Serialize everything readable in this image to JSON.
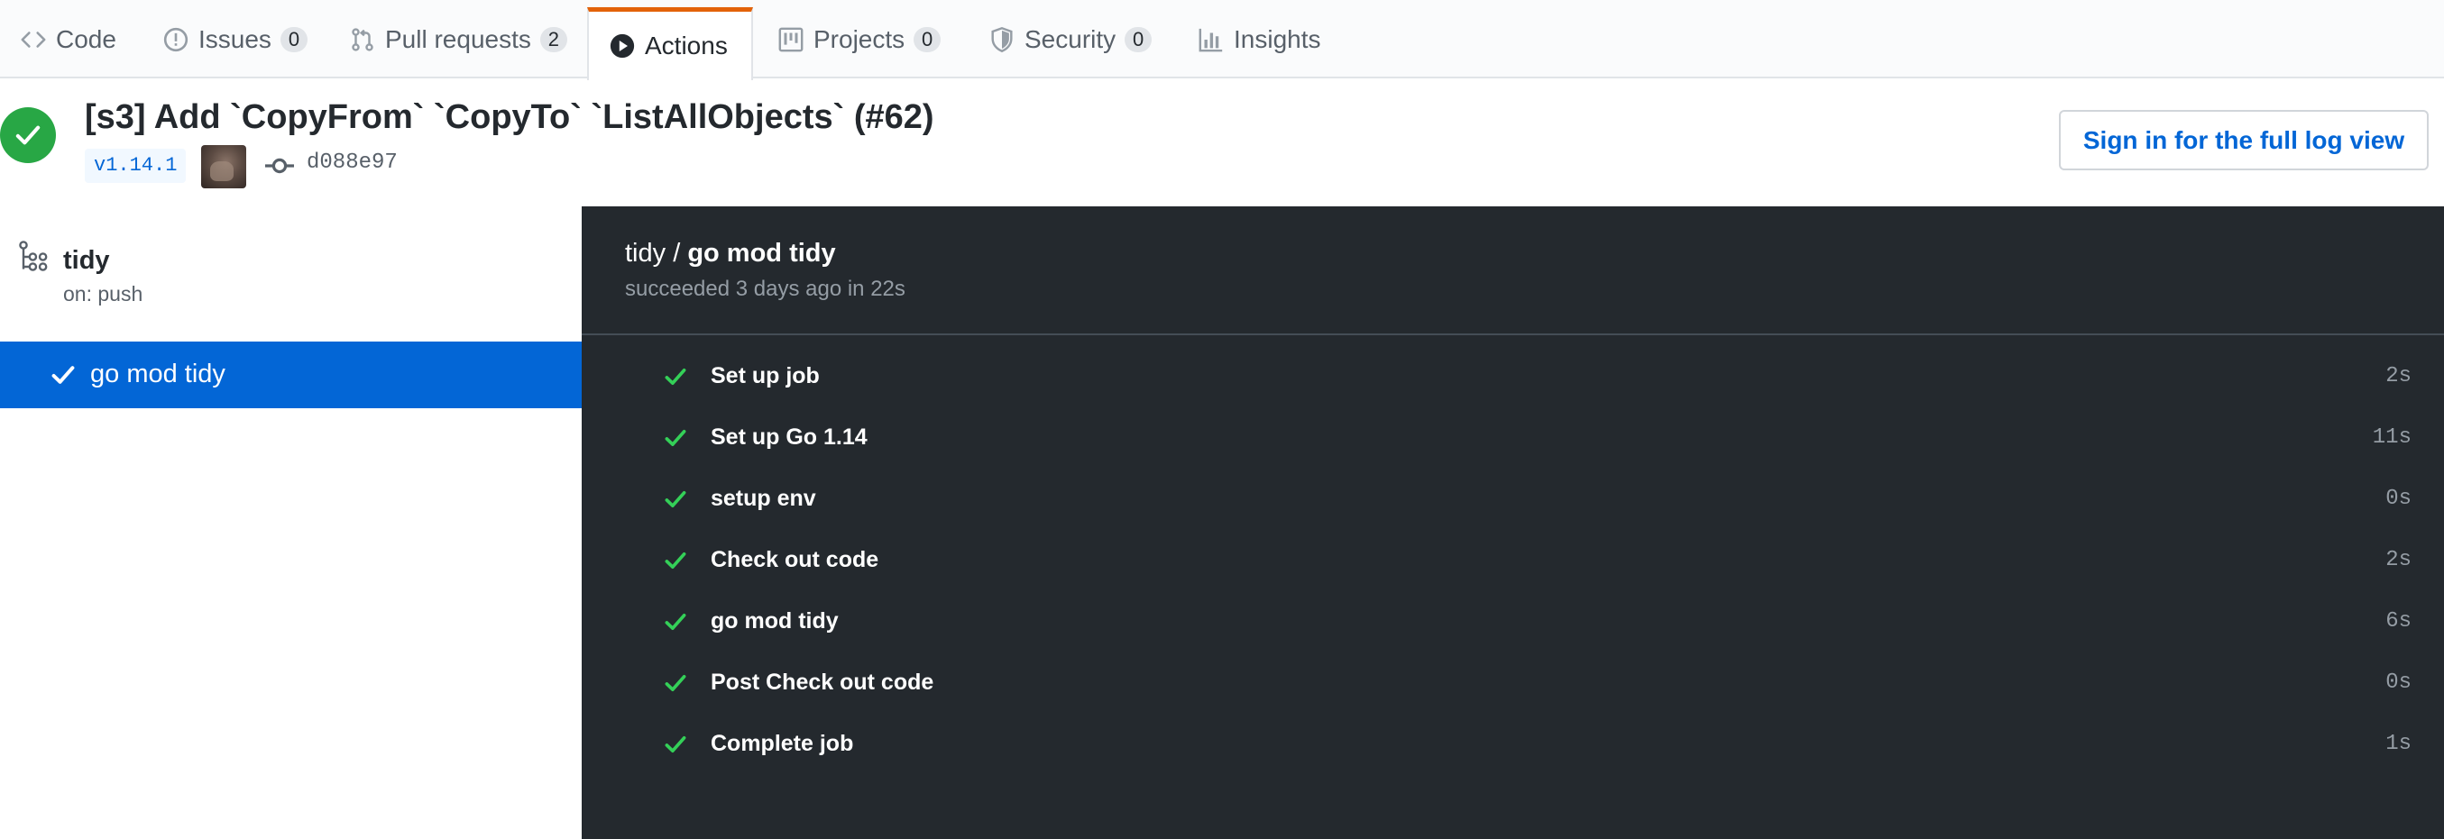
{
  "tabs": [
    {
      "label": "Code",
      "icon": "code-icon"
    },
    {
      "label": "Issues",
      "icon": "issue-icon",
      "count": "0"
    },
    {
      "label": "Pull requests",
      "icon": "pull-request-icon",
      "count": "2"
    },
    {
      "label": "Actions",
      "icon": "play-icon",
      "selected": true
    },
    {
      "label": "Projects",
      "icon": "project-icon",
      "count": "0"
    },
    {
      "label": "Security",
      "icon": "shield-icon",
      "count": "0"
    },
    {
      "label": "Insights",
      "icon": "graph-icon"
    }
  ],
  "header": {
    "status": "success",
    "title": "[s3] Add `CopyFrom` `CopyTo` `ListAllObjects` (#62)",
    "tag": "v1.14.1",
    "commit_sha": "d088e97",
    "signin_label": "Sign in for the full log view"
  },
  "sidebar": {
    "workflow_name": "tidy",
    "workflow_trigger": "on: push",
    "jobs": [
      {
        "label": "go mod tidy",
        "status": "success",
        "selected": true
      }
    ]
  },
  "log": {
    "workflow": "tidy",
    "separator": " / ",
    "job": "go mod tidy",
    "subtitle": "succeeded 3 days ago in 22s",
    "steps": [
      {
        "name": "Set up job",
        "time": "2s"
      },
      {
        "name": "Set up Go 1.14",
        "time": "11s"
      },
      {
        "name": "setup env",
        "time": "0s"
      },
      {
        "name": "Check out code",
        "time": "2s"
      },
      {
        "name": "go mod tidy",
        "time": "6s"
      },
      {
        "name": "Post Check out code",
        "time": "0s"
      },
      {
        "name": "Complete job",
        "time": "1s"
      }
    ]
  },
  "colors": {
    "success": "#28a745",
    "link": "#0366d6",
    "accent_tab": "#e36209",
    "log_bg": "#24292e"
  }
}
